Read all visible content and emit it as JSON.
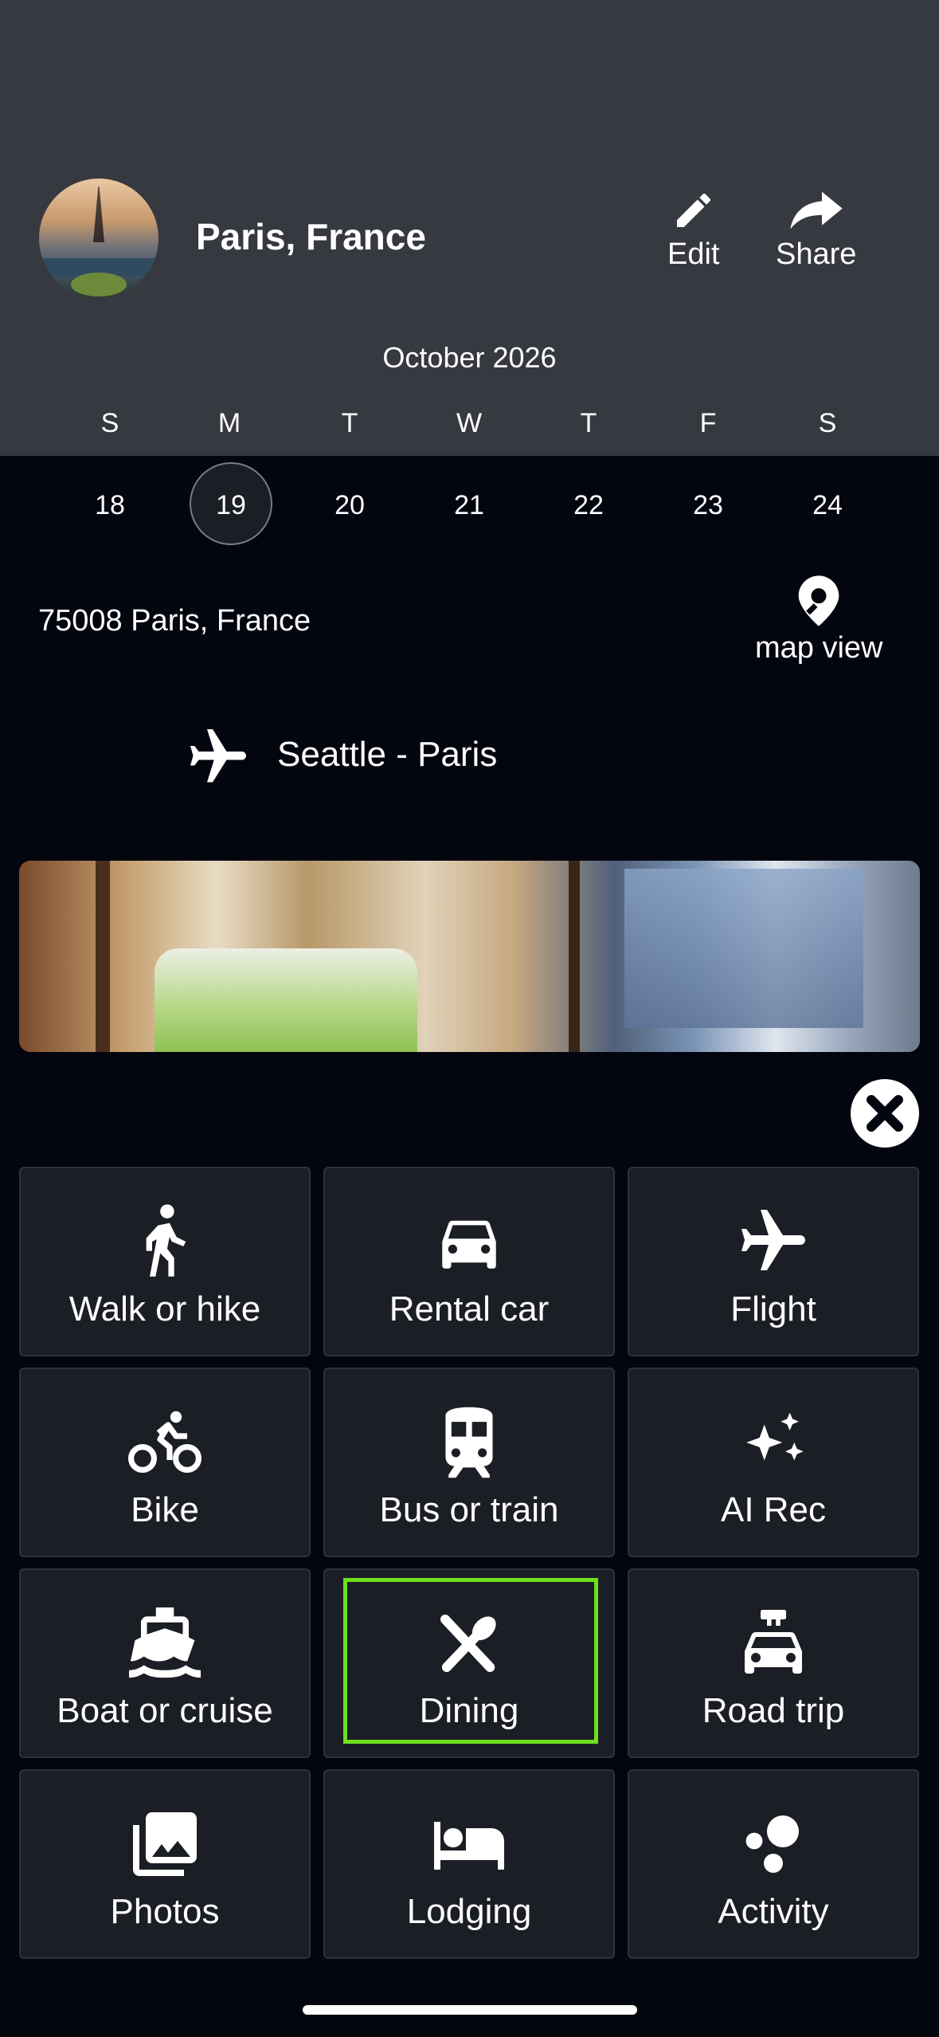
{
  "header": {
    "title": "Paris, France",
    "edit_label": "Edit",
    "share_label": "Share"
  },
  "calendar": {
    "month": "October 2026",
    "weekdays": [
      "S",
      "M",
      "T",
      "W",
      "T",
      "F",
      "S"
    ],
    "days": [
      "18",
      "19",
      "20",
      "21",
      "22",
      "23",
      "24"
    ],
    "selected_day": "19"
  },
  "location": {
    "address": "75008 Paris, France",
    "map_view_label": "map view"
  },
  "trip": {
    "flight_route": "Seattle - Paris"
  },
  "menu": {
    "items": [
      {
        "label": "Walk or hike",
        "icon": "walk-icon"
      },
      {
        "label": "Rental car",
        "icon": "car-icon"
      },
      {
        "label": "Flight",
        "icon": "airplane-icon"
      },
      {
        "label": "Bike",
        "icon": "bike-icon"
      },
      {
        "label": "Bus or train",
        "icon": "train-icon"
      },
      {
        "label": "AI Rec",
        "icon": "sparkle-icon"
      },
      {
        "label": "Boat or cruise",
        "icon": "boat-icon"
      },
      {
        "label": "Dining",
        "icon": "dining-icon"
      },
      {
        "label": "Road trip",
        "icon": "road-trip-icon"
      },
      {
        "label": "Photos",
        "icon": "photos-icon"
      },
      {
        "label": "Lodging",
        "icon": "bed-icon"
      },
      {
        "label": "Activity",
        "icon": "activity-icon"
      }
    ],
    "highlighted": "Dining",
    "highlight_color": "#6de01c"
  },
  "colors": {
    "header_bg": "#373940",
    "body_bg": "#03050f",
    "tile_bg": "#1c1e25"
  }
}
